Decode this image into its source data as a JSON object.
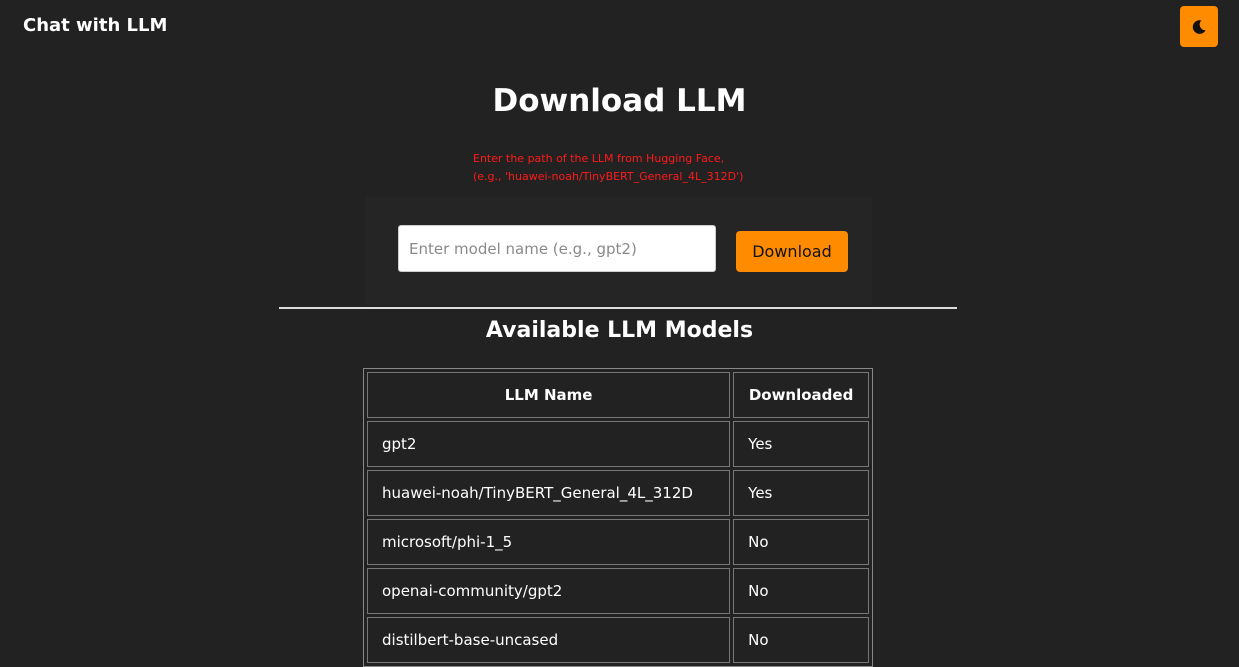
{
  "header": {
    "app_title": "Chat with LLM",
    "theme_toggle_icon": "moon-icon"
  },
  "main": {
    "title": "Download LLM",
    "hint_line1": "Enter the path of the LLM from Hugging Face,",
    "hint_line2": "(e.g., 'huawei-noah/TinyBERT_General_4L_312D')",
    "input_placeholder": "Enter model name (e.g., gpt2)",
    "input_value": "",
    "download_label": "Download"
  },
  "models": {
    "title": "Available LLM Models",
    "columns": [
      "LLM Name",
      "Downloaded"
    ],
    "rows": [
      {
        "name": "gpt2",
        "downloaded": "Yes"
      },
      {
        "name": "huawei-noah/TinyBERT_General_4L_312D",
        "downloaded": "Yes"
      },
      {
        "name": "microsoft/phi-1_5",
        "downloaded": "No"
      },
      {
        "name": "openai-community/gpt2",
        "downloaded": "No"
      },
      {
        "name": "distilbert-base-uncased",
        "downloaded": "No"
      }
    ]
  },
  "colors": {
    "background": "#222222",
    "accent": "#ff8c00",
    "hint": "#ff1a1a",
    "text": "#ffffff"
  }
}
